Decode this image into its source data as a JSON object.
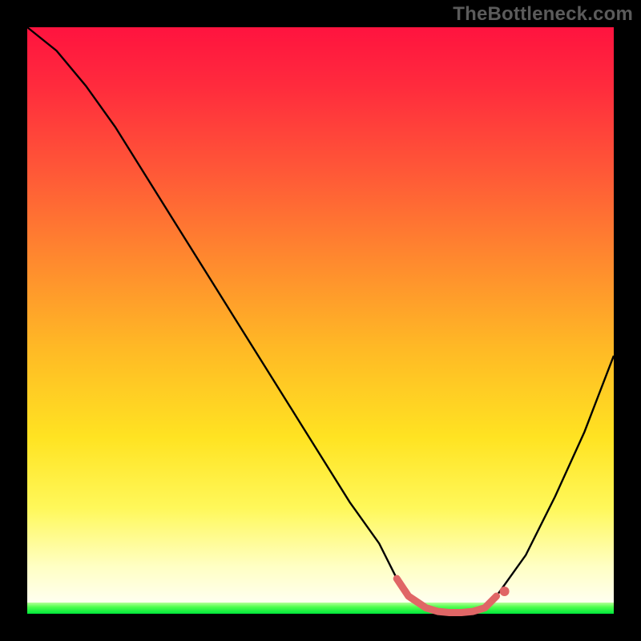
{
  "watermark": "TheBottleneck.com",
  "colors": {
    "background": "#000000",
    "gradient_top": "#ff133f",
    "gradient_mid1": "#ff8a2e",
    "gradient_mid2": "#ffe322",
    "gradient_bottom": "#ffffff",
    "green_strip_top": "#b7ff9a",
    "green_strip_bottom": "#00e63b",
    "curve": "#000000",
    "highlight": "#e06666"
  },
  "chart_data": {
    "type": "line",
    "title": "",
    "xlabel": "",
    "ylabel": "",
    "xlim": [
      0,
      100
    ],
    "ylim": [
      0,
      100
    ],
    "series": [
      {
        "name": "bottleneck-curve",
        "x": [
          0,
          5,
          10,
          15,
          20,
          25,
          30,
          35,
          40,
          45,
          50,
          55,
          60,
          63,
          65,
          68,
          70,
          72,
          74,
          76,
          78,
          80,
          85,
          90,
          95,
          100
        ],
        "values": [
          100,
          96,
          90,
          83,
          75,
          67,
          59,
          51,
          43,
          35,
          27,
          19,
          12,
          6,
          3,
          1,
          0.4,
          0.2,
          0.2,
          0.4,
          1,
          3,
          10,
          20,
          31,
          44
        ]
      }
    ],
    "highlight_segment": {
      "name": "optimal-range",
      "x_start": 63,
      "x_end": 80,
      "y_approx": 0.5
    },
    "annotations": []
  }
}
